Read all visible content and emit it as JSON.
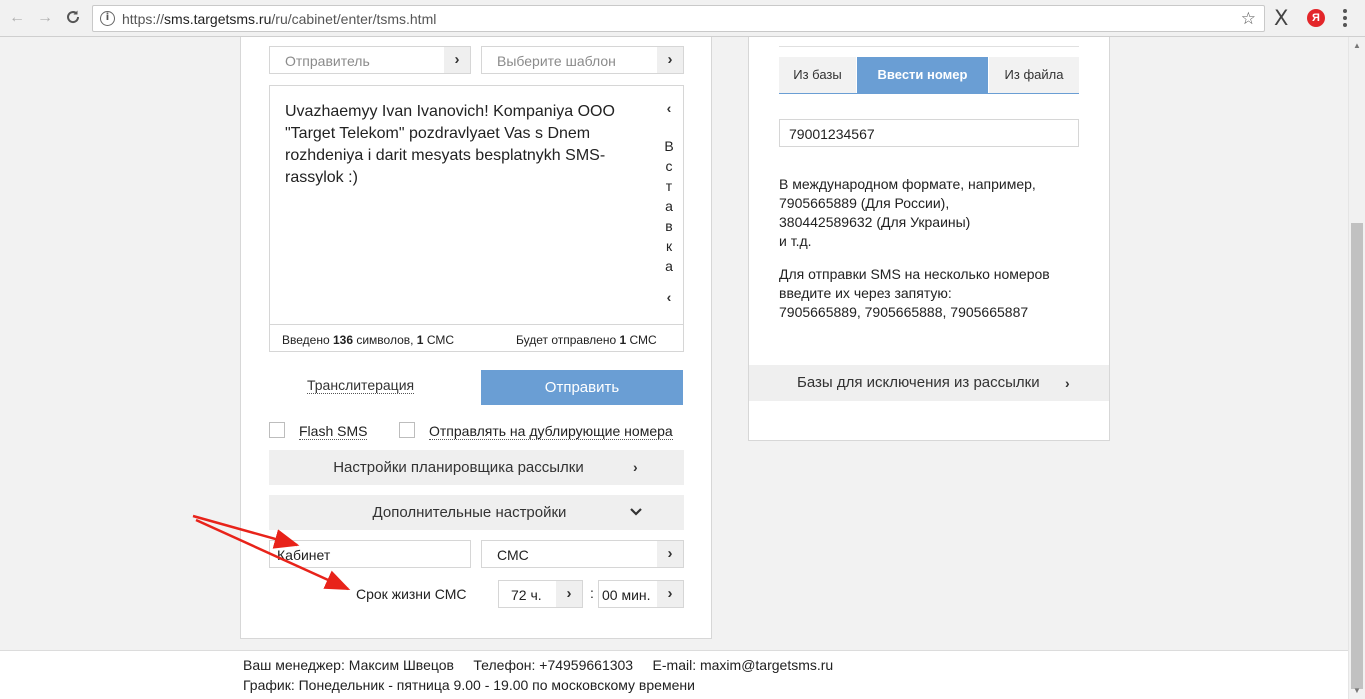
{
  "browser": {
    "url_prefix": "https://",
    "url_host": "sms.targetsms.ru",
    "url_path": "/ru/cabinet/enter/tsms.html",
    "back_icon": "←",
    "forward_icon": "→",
    "reload_icon": "C",
    "info_icon": "i",
    "star_icon": "☆",
    "extension_x": "X",
    "yandex_icon": "Я"
  },
  "form": {
    "sender_placeholder": "Отправитель",
    "template_placeholder": "Выберите шаблон",
    "message_text": "Uvazhaemyy Ivan Ivanovich! Kompaniya OOO \"Target Telekom\" pozdravlyaet Vas s Dnem rozhdeniya i darit mesyats besplatnykh SMS-rassylok :)",
    "insert_letters": [
      "В",
      "с",
      "т",
      "а",
      "в",
      "к",
      "а"
    ],
    "counter_prefix": "Введено ",
    "counter_chars": "136",
    "counter_mid": " символов, ",
    "counter_sms": "1",
    "counter_suffix": " СМС",
    "will_send_prefix": "Будет отправлено ",
    "will_send_count": "1",
    "will_send_suffix": " СМС",
    "translit_link": "Транслитерация",
    "send_button": "Отправить",
    "flash_sms_label": "Flash SMS",
    "duplicate_label": "Отправлять на дублирующие номера",
    "scheduler_bar": "Настройки планировщика рассылки",
    "extra_settings_bar": "Дополнительные настройки",
    "cabinet_value": "Кабинет",
    "sms_type_value": "СМС",
    "lifetime_label": "Срок жизни СМС",
    "hours_value": "72 ч.",
    "minutes_value": "00 мин.",
    "colon": ":"
  },
  "recipients": {
    "tabs": [
      {
        "label": "Из базы",
        "active": false
      },
      {
        "label": "Ввести номер",
        "active": true
      },
      {
        "label": "Из файла",
        "active": false
      }
    ],
    "phone_value": "79001234567",
    "help1_lines": [
      "В международном формате, например,",
      "7905665889 (Для России),",
      "380442589632 (Для Украины)",
      "и т.д."
    ],
    "help2_lines": [
      "Для отправки SMS на несколько номеров",
      "введите их через запятую:",
      "7905665889, 7905665888, 7905665887"
    ],
    "exclude_bar": "Базы для исключения из рассылки"
  },
  "footer": {
    "manager": "Ваш менеджер: Максим Швецов     Телефон: +74959661303     E-mail: maxim@targetsms.ru",
    "schedule": "График: Понедельник - пятница 9.00 - 19.00 по московскому времени"
  },
  "colors": {
    "accent": "#6a9ed4",
    "annotation_arrow": "#e8231a"
  }
}
